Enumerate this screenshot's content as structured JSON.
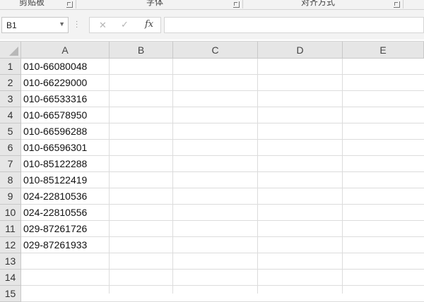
{
  "ribbon": {
    "groups": [
      {
        "label": "剪贴板"
      },
      {
        "label": "字体"
      },
      {
        "label": "对齐方式"
      }
    ]
  },
  "formula_bar": {
    "name_box": "B1",
    "cancel_icon": "✕",
    "enter_icon": "✓",
    "fx_label": "fx",
    "formula_value": ""
  },
  "sheet": {
    "columns": [
      "A",
      "B",
      "C",
      "D",
      "E"
    ],
    "rows": [
      "1",
      "2",
      "3",
      "4",
      "5",
      "6",
      "7",
      "8",
      "9",
      "10",
      "11",
      "12",
      "13",
      "14",
      "15"
    ],
    "column_a_values": [
      "010-66080048",
      "010-66229000",
      "010-66533316",
      "010-66578950",
      "010-66596288",
      "010-66596301",
      "010-85122288",
      "010-85122419",
      "024-22810536",
      "024-22810556",
      "029-87261726",
      "029-87261933"
    ]
  }
}
